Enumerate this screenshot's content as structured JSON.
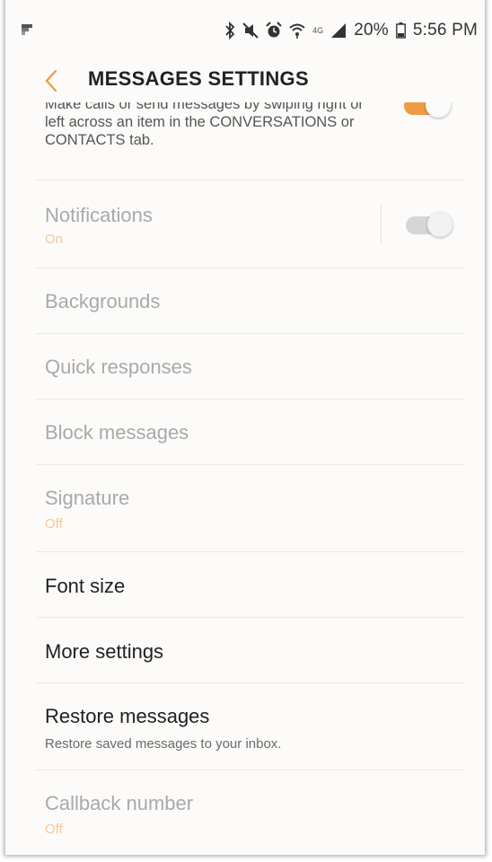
{
  "status_bar": {
    "battery_percent": "20%",
    "time": "5:56 PM",
    "network_label": "4G",
    "icons": [
      "flipboard-icon",
      "bluetooth-icon",
      "mute-icon",
      "alarm-icon",
      "wifi-icon",
      "signal-icon",
      "battery-icon"
    ]
  },
  "header": {
    "title": "MESSAGES SETTINGS",
    "back_icon": "chevron-left-icon"
  },
  "settings": {
    "swipe_description": "Make calls or send messages by swiping right or left across an item in the CONVERSATIONS or CONTACTS tab.",
    "swipe_toggle_on": true,
    "notifications": {
      "title": "Notifications",
      "status": "On",
      "toggle_on": true
    },
    "backgrounds": {
      "title": "Backgrounds"
    },
    "quick_responses": {
      "title": "Quick responses"
    },
    "block_messages": {
      "title": "Block messages"
    },
    "signature": {
      "title": "Signature",
      "status": "Off"
    },
    "font_size": {
      "title": "Font size"
    },
    "more_settings": {
      "title": "More settings"
    },
    "restore_messages": {
      "title": "Restore messages",
      "description": "Restore saved messages to your inbox."
    },
    "callback_number": {
      "title": "Callback number",
      "status": "Off"
    }
  },
  "colors": {
    "accent": "#ef9a45",
    "accent_dim": "#f5c79c",
    "disabled_text": "#a9a9a9",
    "toggle_disabled": "#d6d6d6"
  }
}
